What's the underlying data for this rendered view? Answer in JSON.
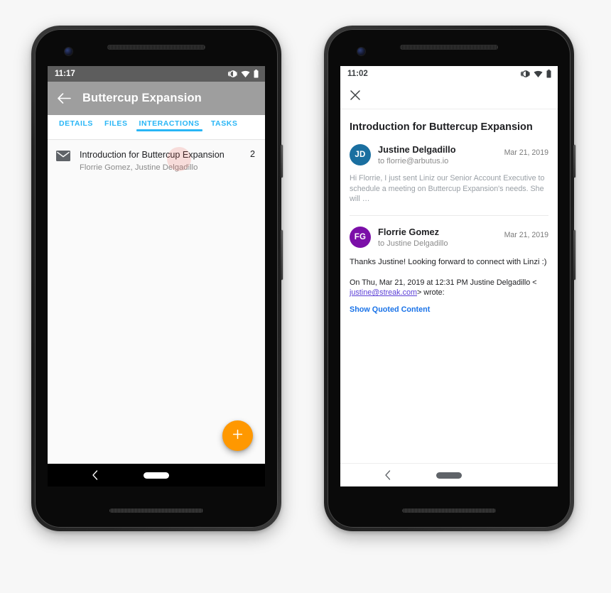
{
  "theme": {
    "tab_accent": "#29b6f6",
    "fab_color": "#ff9800",
    "appbar_color": "#9e9e9e",
    "avatar_jd_color": "#1a6fa0",
    "avatar_fg_color": "#7b0fa8",
    "link_color": "#1a73e8",
    "quoted_link_color": "#5b3fd6"
  },
  "phone_left": {
    "status_bar": {
      "time": "11:17",
      "icons": [
        "vibrate-icon",
        "wifi-icon",
        "battery-icon"
      ]
    },
    "app_bar": {
      "back_icon": "back-arrow-icon",
      "title": "Buttercup Expansion"
    },
    "tabs": [
      {
        "label": "DETAILS",
        "active": false
      },
      {
        "label": "FILES",
        "active": false
      },
      {
        "label": "INTERACTIONS",
        "active": true
      },
      {
        "label": "TASKS",
        "active": false
      }
    ],
    "interactions": [
      {
        "icon": "envelope-icon",
        "subject": "Introduction for Buttercup Expansion",
        "people": "Florrie Gomez, Justine Delgadillo",
        "count": "2"
      }
    ],
    "fab": {
      "icon": "plus-icon",
      "label": "+"
    },
    "nav_bar": {
      "back_icon": "nav-back-icon",
      "home_icon": "home-pill-icon"
    }
  },
  "phone_right": {
    "status_bar": {
      "time": "11:02",
      "icons": [
        "vibrate-icon",
        "wifi-icon",
        "battery-icon"
      ]
    },
    "close_icon": "close-icon",
    "thread_title": "Introduction for Buttercup Expansion",
    "messages": [
      {
        "avatar_initials": "JD",
        "from": "Justine Delgadillo",
        "to": "to florrie@arbutus.io",
        "date": "Mar 21, 2019",
        "snippet": "Hi Florrie, I just sent Liniz our Senior Account Executive to schedule a meeting on Buttercup Expansion's needs. She will …",
        "collapsed": true
      },
      {
        "avatar_initials": "FG",
        "from": "Florrie Gomez",
        "to": "to Justine Delgadillo",
        "date": "Mar 21, 2019",
        "body": "Thanks Justine! Looking forward to connect with Linzi :)",
        "quote_prefix": "On Thu, Mar 21, 2019 at 12:31 PM Justine Delgadillo <",
        "quote_email": "justine@streak.com",
        "quote_suffix": "> wrote:",
        "show_quoted_label": "Show Quoted Content",
        "collapsed": false
      }
    ],
    "nav_bar": {
      "back_icon": "nav-back-icon",
      "home_icon": "home-pill-icon"
    }
  }
}
